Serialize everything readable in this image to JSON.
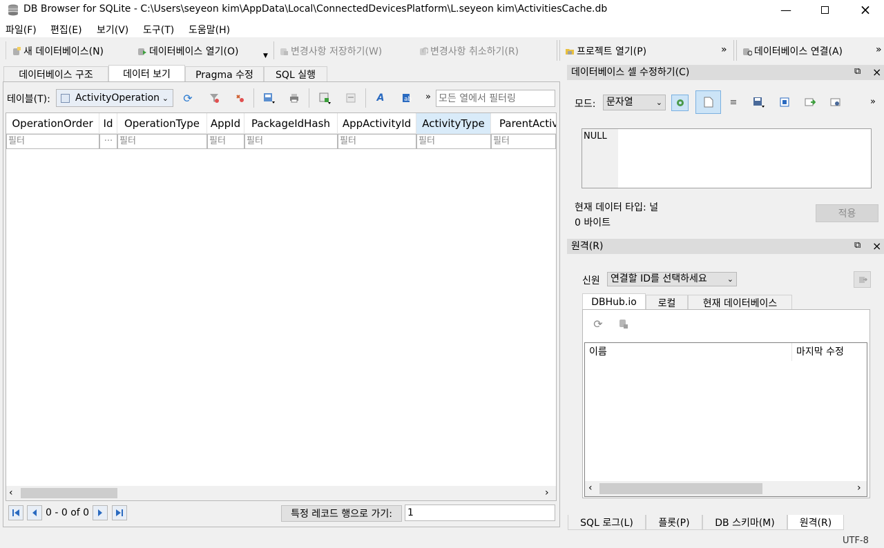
{
  "window": {
    "title": "DB Browser for SQLite - C:\\Users\\seyeon kim\\AppData\\Local\\ConnectedDevicesPlatform\\L.seyeon kim\\ActivitiesCache.db"
  },
  "menu": [
    "파일(F)",
    "편집(E)",
    "보기(V)",
    "도구(T)",
    "도움말(H)"
  ],
  "toolbar": {
    "new_db": "새 데이터베이스(N)",
    "open_db": "데이터베이스 열기(O)",
    "write_changes": "변경사항 저장하기(W)",
    "revert_changes": "변경사항 취소하기(R)",
    "open_project": "프로젝트 열기(P)",
    "attach_db": "데이터베이스 연결(A)",
    "overflow": "»"
  },
  "main_tabs": [
    "데이터베이스 구조",
    "데이터 보기",
    "Pragma 수정",
    "SQL 실행"
  ],
  "browse": {
    "table_label": "테이블(T):",
    "table_value": "ActivityOperation",
    "filter_placeholder": "모든 열에서 필터링",
    "overflow": "»",
    "columns": [
      "OperationOrder",
      "Id",
      "OperationType",
      "AppId",
      "PackageIdHash",
      "AppActivityId",
      "ActivityType",
      "ParentActiv"
    ],
    "filter_labels": [
      "필터",
      "···",
      "필터",
      "필터",
      "필터",
      "필터",
      "필터",
      "필터"
    ],
    "record_status": "0 - 0 of 0",
    "goto_label": "특정 레코드 행으로 가기:",
    "goto_value": "1"
  },
  "edit_cell": {
    "title": "데이터베이스 셀 수정하기(C)",
    "mode_label": "모드:",
    "mode_value": "문자열",
    "overflow": "»",
    "content": "NULL",
    "type_label": "현재 데이터 타입: 널",
    "size_label": "0 바이트",
    "apply_button": "적용"
  },
  "remote": {
    "title": "원격(R)",
    "identity_label": "신원",
    "identity_value": "연결할 ID를 선택하세요",
    "tabs": [
      "DBHub.io",
      "로컬",
      "현재 데이터베이스"
    ],
    "columns": [
      "이름",
      "마지막 수정"
    ]
  },
  "bottom_tabs": [
    "SQL 로그(L)",
    "플롯(P)",
    "DB 스키마(M)",
    "원격(R)"
  ],
  "status": {
    "encoding": "UTF-8"
  }
}
